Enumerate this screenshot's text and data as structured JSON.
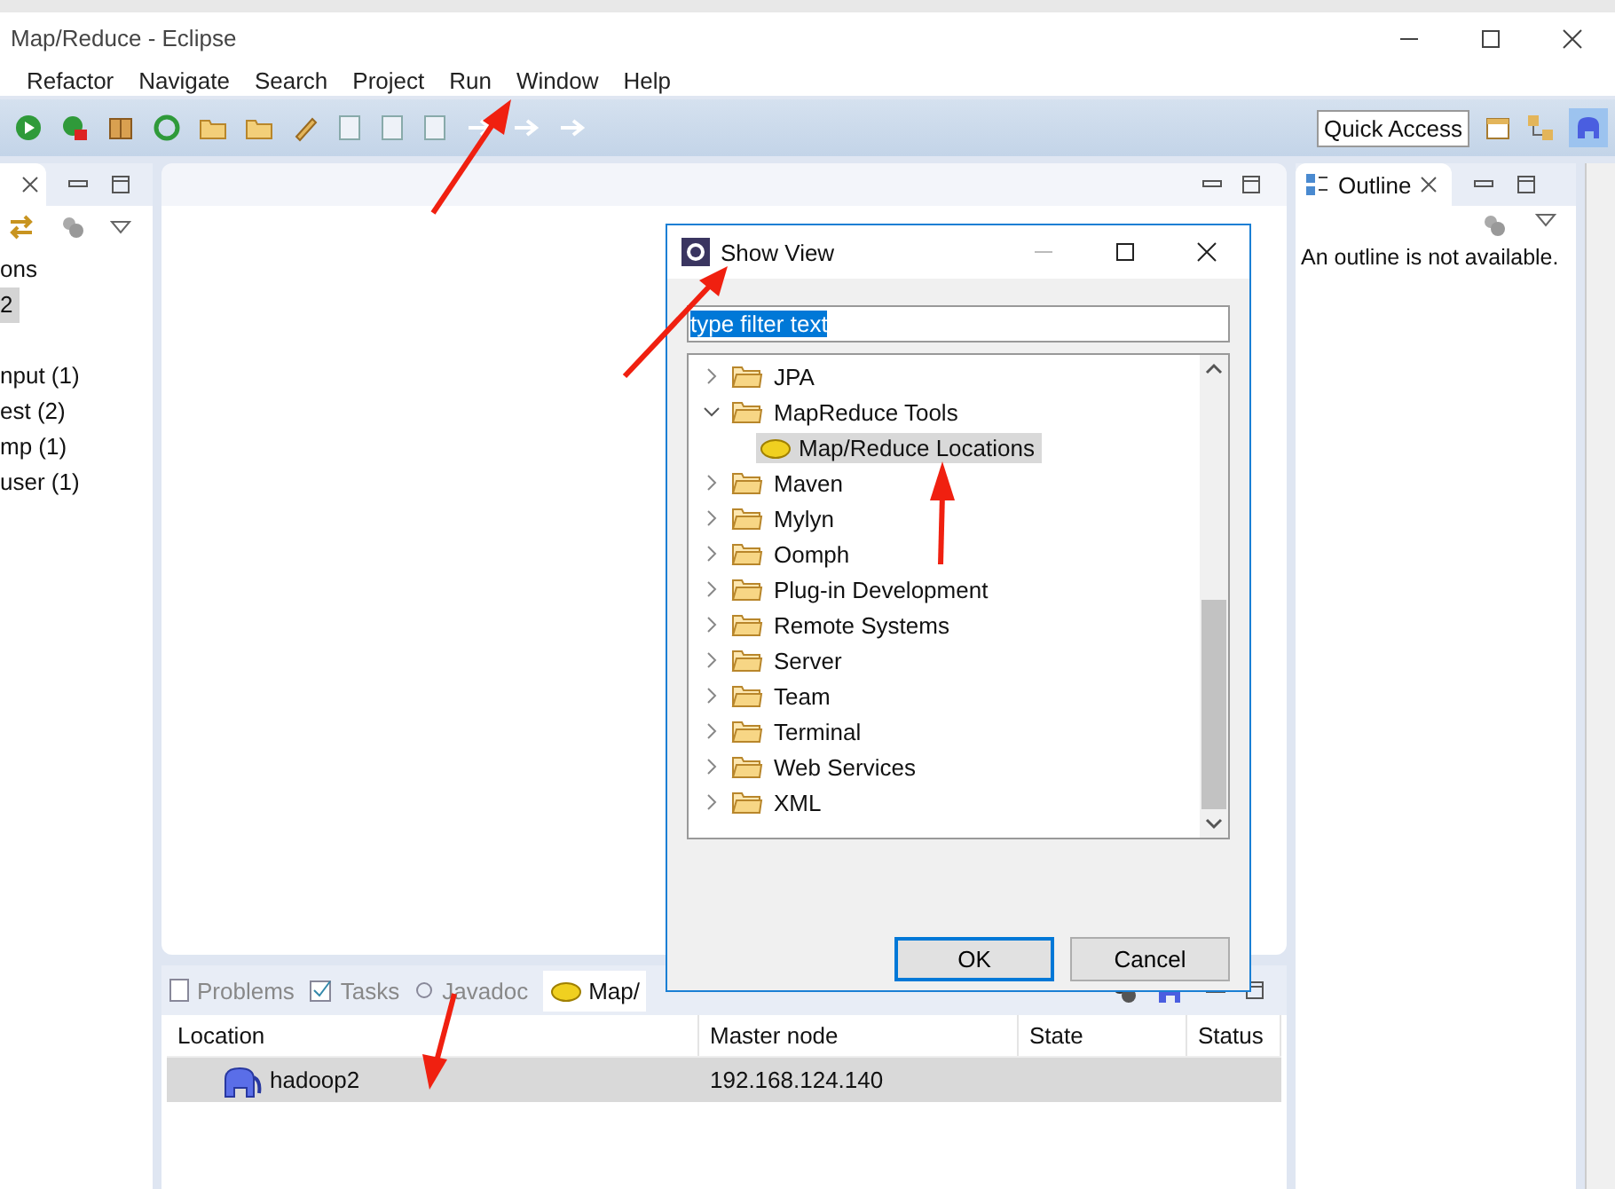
{
  "window": {
    "title": "Map/Reduce - Eclipse"
  },
  "menu": [
    "Refactor",
    "Navigate",
    "Search",
    "Project",
    "Run",
    "Window",
    "Help"
  ],
  "toolbar": {
    "quick_access": "Quick Access"
  },
  "left_view": {
    "items": [
      {
        "label": "ons",
        "selected": false
      },
      {
        "label": "2",
        "selected": true
      },
      {
        "label": "nput (1)",
        "selected": false
      },
      {
        "label": "est (2)",
        "selected": false
      },
      {
        "label": "mp (1)",
        "selected": false
      },
      {
        "label": "user (1)",
        "selected": false
      }
    ]
  },
  "outline": {
    "title": "Outline",
    "message": "An outline is not available."
  },
  "bottom_panel": {
    "tabs": [
      {
        "label": "Problems",
        "selected": false
      },
      {
        "label": "Tasks",
        "selected": false
      },
      {
        "label": "Javadoc",
        "selected": false
      },
      {
        "label": "Map/",
        "selected": true
      }
    ],
    "columns": [
      "Location",
      "Master node",
      "State",
      "Status"
    ],
    "rows": [
      {
        "location": "hadoop2",
        "master_node": "192.168.124.140",
        "selected": true
      }
    ]
  },
  "dialog": {
    "title": "Show View",
    "filter": {
      "value": "type filter text",
      "selected": true
    },
    "tree": [
      {
        "label": "JPA",
        "expanded": false
      },
      {
        "label": "MapReduce Tools",
        "expanded": true,
        "children": [
          {
            "label": "Map/Reduce Locations",
            "selected": true
          }
        ]
      },
      {
        "label": "Maven",
        "expanded": false
      },
      {
        "label": "Mylyn",
        "expanded": false
      },
      {
        "label": "Oomph",
        "expanded": false
      },
      {
        "label": "Plug-in Development",
        "expanded": false
      },
      {
        "label": "Remote Systems",
        "expanded": false
      },
      {
        "label": "Server",
        "expanded": false
      },
      {
        "label": "Team",
        "expanded": false
      },
      {
        "label": "Terminal",
        "expanded": false
      },
      {
        "label": "Web Services",
        "expanded": false
      },
      {
        "label": "XML",
        "expanded": false
      }
    ],
    "buttons": [
      {
        "label": "OK",
        "default": true
      },
      {
        "label": "Cancel",
        "default": false
      }
    ]
  }
}
